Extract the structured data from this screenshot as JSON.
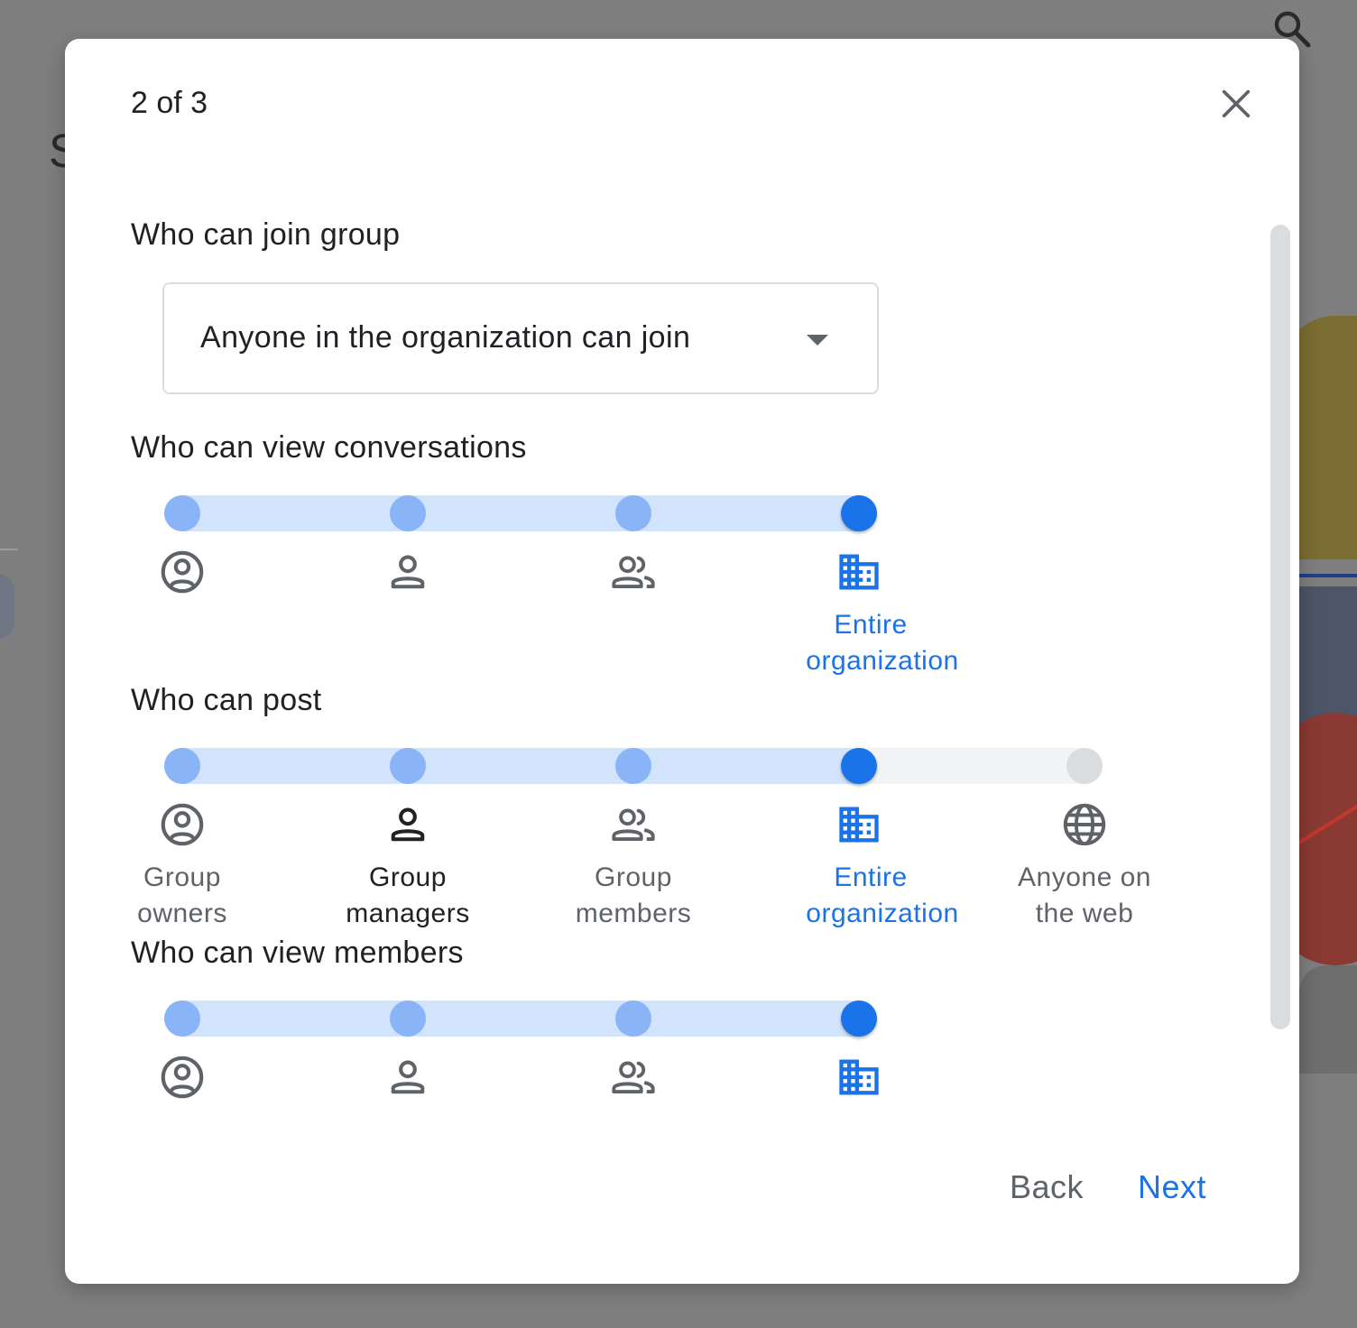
{
  "dialog": {
    "step_counter": "2 of 3",
    "close_icon": "close-icon"
  },
  "background": {
    "partial_letter": "S",
    "search_icon": "search-icon"
  },
  "join": {
    "title": "Who can join group",
    "dropdown_value": "Anyone in the organization can join"
  },
  "view_conversations": {
    "title": "Who can view conversations",
    "selected_index": 3,
    "selected_label_line1": "Entire",
    "selected_label_line2": "organization"
  },
  "post": {
    "title": "Who can post",
    "selected_index": 3,
    "options": [
      {
        "line1": "Group",
        "line2": "owners",
        "icon": "owner-icon"
      },
      {
        "line1": "Group",
        "line2": "managers",
        "icon": "manager-icon"
      },
      {
        "line1": "Group",
        "line2": "members",
        "icon": "members-icon"
      },
      {
        "line1": "Entire",
        "line2": "organization",
        "icon": "organization-icon"
      },
      {
        "line1": "Anyone on",
        "line2": "the web",
        "icon": "globe-icon"
      }
    ]
  },
  "view_members": {
    "title": "Who can view members",
    "selected_index": 3
  },
  "footer": {
    "back_label": "Back",
    "next_label": "Next"
  },
  "colors": {
    "accent": "#1a73e8",
    "track_active": "#d2e3fc",
    "dot_active": "#8ab4f8",
    "text_primary": "#202124",
    "text_secondary": "#5f6368"
  }
}
